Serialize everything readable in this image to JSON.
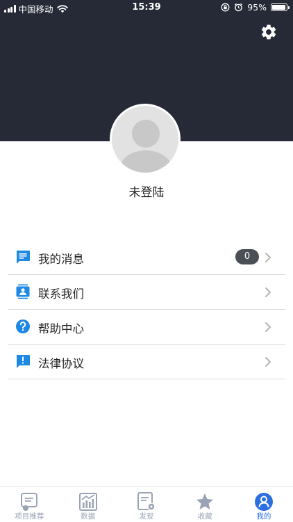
{
  "status_bar": {
    "carrier": "中国移动",
    "time": "15:39",
    "battery": "95%",
    "battery_level": 0.95
  },
  "header": {
    "settings_icon": "gear-icon",
    "user_name": "未登陆"
  },
  "menu": {
    "items": [
      {
        "label": "我的消息",
        "icon": "message-icon",
        "badge": "0"
      },
      {
        "label": "联系我们",
        "icon": "contact-icon"
      },
      {
        "label": "帮助中心",
        "icon": "help-icon"
      },
      {
        "label": "法律协议",
        "icon": "legal-icon"
      }
    ]
  },
  "tabbar": {
    "tabs": [
      {
        "label": "项目推荐",
        "icon": "recommend-icon",
        "active": false
      },
      {
        "label": "数据",
        "icon": "chart-icon",
        "active": false
      },
      {
        "label": "发现",
        "icon": "discover-icon",
        "active": false
      },
      {
        "label": "收藏",
        "icon": "star-icon",
        "active": false
      },
      {
        "label": "我的",
        "icon": "profile-icon",
        "active": true
      }
    ]
  },
  "colors": {
    "header_bg": "#252a36",
    "accent": "#2e6fe0",
    "icon_blue": "#1e88e5",
    "tab_inactive": "#9aa3b5",
    "badge_bg": "#4a4f56"
  }
}
